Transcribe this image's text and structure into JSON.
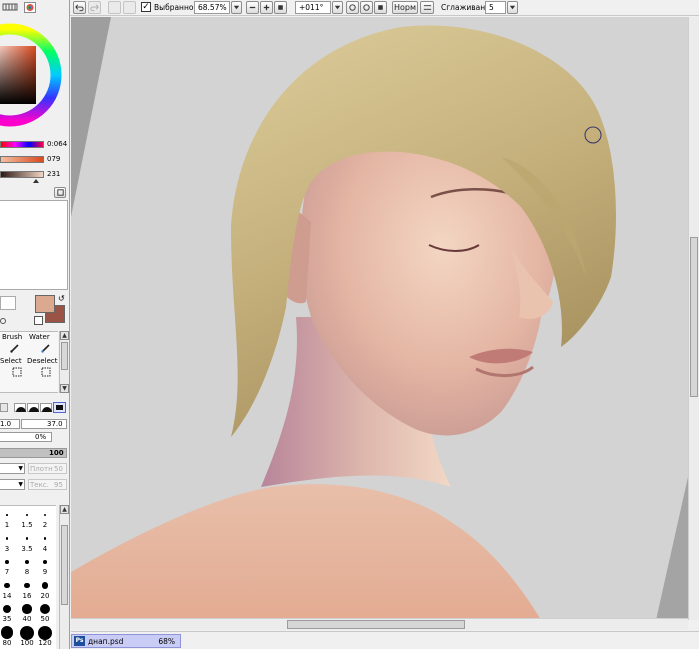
{
  "toolbar": {
    "selection_label": "Выбранное",
    "zoom": "68.57%",
    "rotation": "+011°",
    "blend_mode": "Норм",
    "smoothing_label": "Сглаживание",
    "smoothing_value": "5"
  },
  "color_panel": {
    "slider_values": [
      "0:064",
      "079",
      "231"
    ],
    "primary_color": "#dba98f",
    "secondary_color": "#9a5344"
  },
  "tools": {
    "row1": [
      "Brush",
      "Water"
    ],
    "row2": [
      "Select",
      "Deselect"
    ]
  },
  "brush_settings": {
    "size_multiplier": "1.0",
    "size_value": "37.0",
    "min_size": "0%",
    "density": "100",
    "blending_label": "Плотн",
    "blending_value": "50",
    "texture_label": "Текс.",
    "texture_value": "95"
  },
  "brush_sizes": [
    "1",
    "1.5",
    "2",
    "3",
    "3.5",
    "4",
    "7",
    "8",
    "9",
    "14",
    "16",
    "20",
    "35",
    "40",
    "50",
    "80",
    "100",
    "120"
  ],
  "document": {
    "filename": "днап.psd",
    "zoom": "68%"
  }
}
